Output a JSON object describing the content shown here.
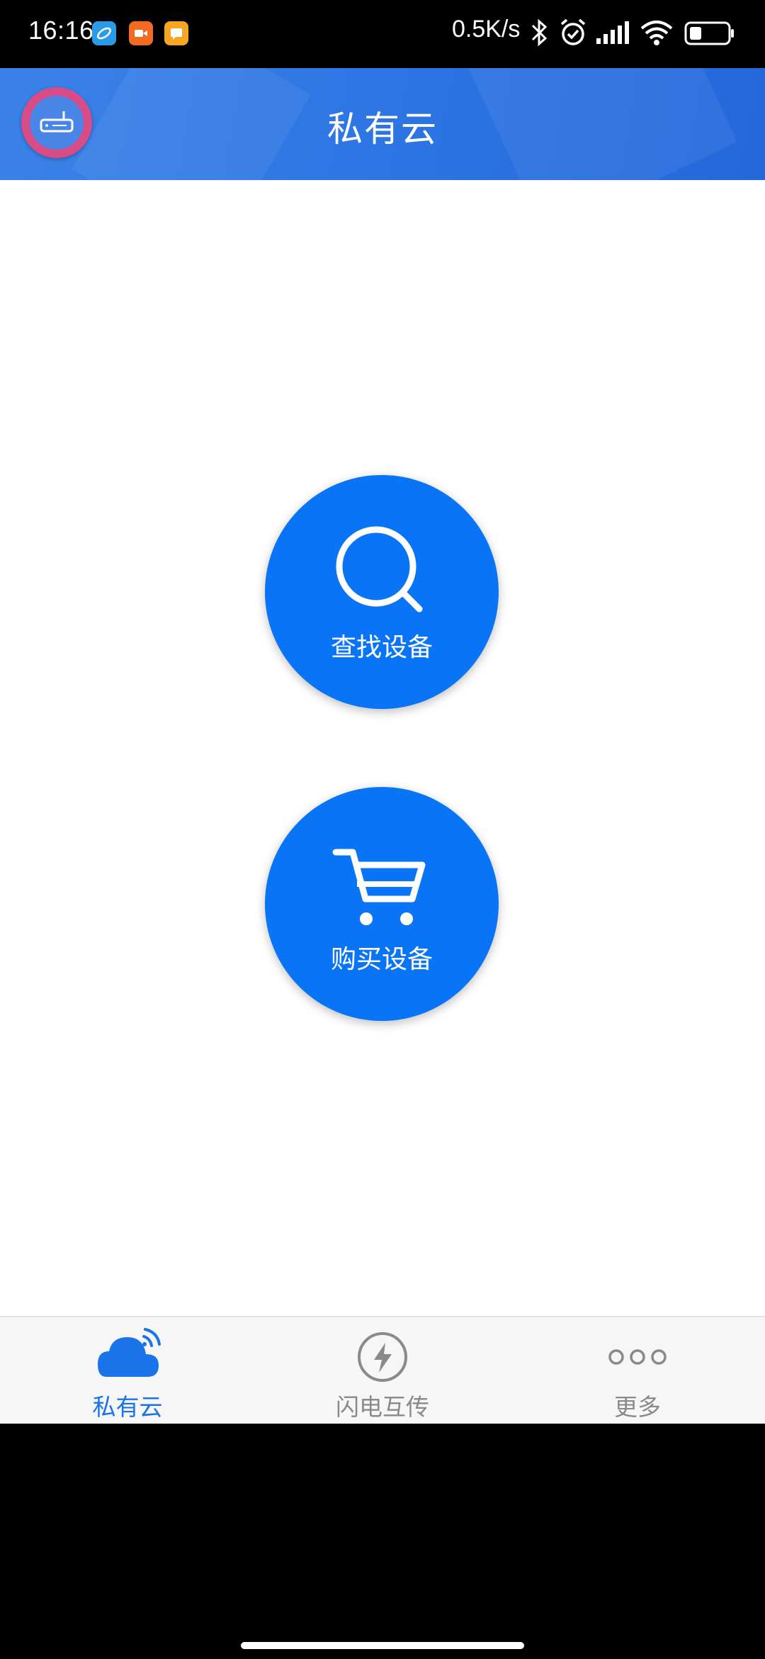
{
  "status_bar": {
    "time": "16:16",
    "net_speed": "0.5K/s",
    "icons": [
      "browser-app-icon",
      "video-app-icon",
      "message-app-icon",
      "bluetooth-icon",
      "alarm-icon",
      "signal-icon",
      "wifi-icon",
      "battery-icon"
    ]
  },
  "header": {
    "title": "私有云",
    "left_icon": "router-icon"
  },
  "main": {
    "find_device": {
      "label": "查找设备",
      "icon": "search-icon"
    },
    "buy_device": {
      "label": "购买设备",
      "icon": "cart-icon"
    }
  },
  "bottom_nav": {
    "items": [
      {
        "label": "私有云",
        "icon": "cloud-icon",
        "active": true
      },
      {
        "label": "闪电互传",
        "icon": "lightning-icon",
        "active": false
      },
      {
        "label": "更多",
        "icon": "more-icon",
        "active": false
      }
    ]
  },
  "colors": {
    "header": "#2f78e4",
    "accent": "#0a74f7",
    "nav_active": "#1a73e8",
    "nav_inactive": "#8a8a8a",
    "router_ring": "#d94b86"
  }
}
